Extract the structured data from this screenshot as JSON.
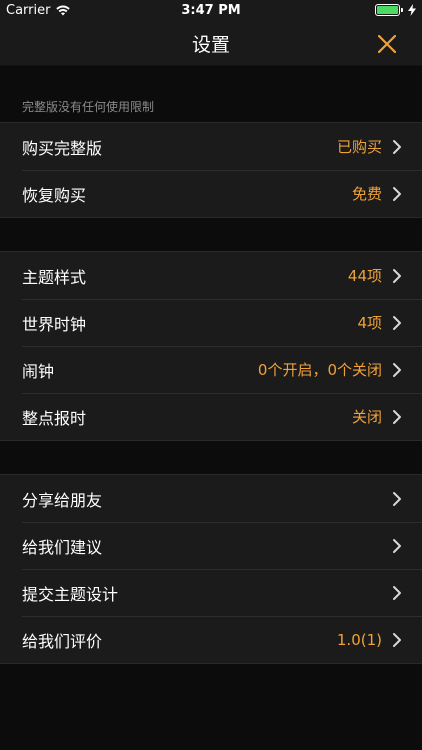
{
  "status_bar": {
    "carrier": "Carrier",
    "time": "3:47 PM",
    "battery_percent": 100
  },
  "nav": {
    "title": "设置",
    "close_icon": "close-icon"
  },
  "caption": "完整版没有任何使用限制",
  "colors": {
    "accent": "#f0a23a",
    "background": "#0c0c0c",
    "cell": "#1b1b1b"
  },
  "groups": [
    {
      "rows": [
        {
          "label": "购买完整版",
          "value": "已购买"
        },
        {
          "label": "恢复购买",
          "value": "免费"
        }
      ]
    },
    {
      "rows": [
        {
          "label": "主题样式",
          "value": "44项"
        },
        {
          "label": "世界时钟",
          "value": "4项"
        },
        {
          "label": "闹钟",
          "value": "0个开启，0个关闭"
        },
        {
          "label": "整点报时",
          "value": "关闭"
        }
      ]
    },
    {
      "rows": [
        {
          "label": "分享给朋友",
          "value": ""
        },
        {
          "label": "给我们建议",
          "value": ""
        },
        {
          "label": "提交主题设计",
          "value": ""
        },
        {
          "label": "给我们评价",
          "value": "1.0(1)"
        }
      ]
    }
  ]
}
